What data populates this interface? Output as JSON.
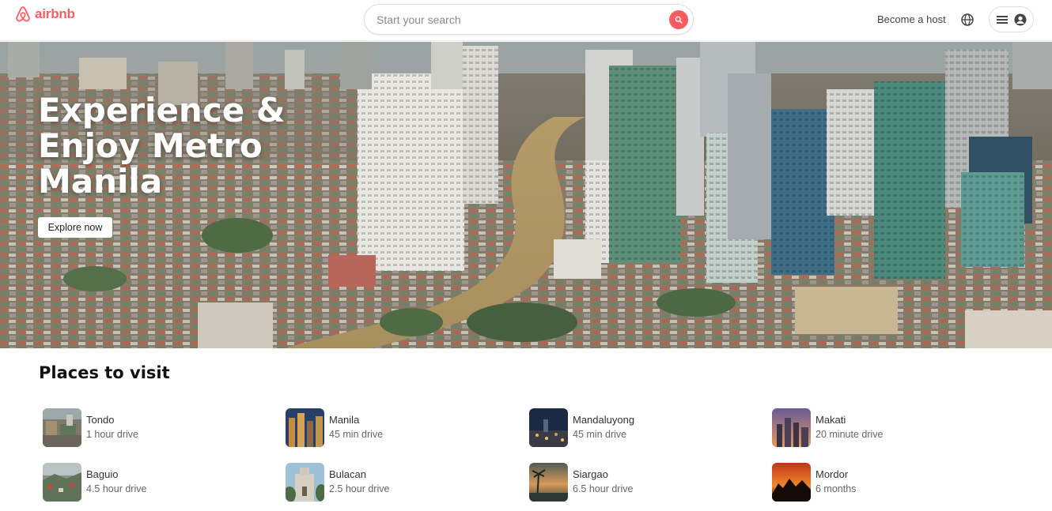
{
  "header": {
    "logo_text": "airbnb",
    "search_placeholder": "Start your search",
    "become_host": "Become a host"
  },
  "hero": {
    "title": "Experience & Enjoy Metro Manila",
    "button": "Explore now"
  },
  "places": {
    "title": "Places to visit",
    "items": [
      {
        "name": "Tondo",
        "distance": "1 hour drive"
      },
      {
        "name": "Manila",
        "distance": "45 min drive"
      },
      {
        "name": "Mandaluyong",
        "distance": "45 min drive"
      },
      {
        "name": "Makati",
        "distance": "20 minute drive"
      },
      {
        "name": "Baguio",
        "distance": "4.5 hour drive"
      },
      {
        "name": "Bulacan",
        "distance": "2.5 hour drive"
      },
      {
        "name": "Siargao",
        "distance": "6.5 hour drive"
      },
      {
        "name": "Mordor",
        "distance": "6 months"
      }
    ]
  },
  "colors": {
    "brand": "#ff5a5f",
    "text": "#222222",
    "muted": "#666666"
  },
  "icons": [
    "airbnb-logo-icon",
    "search-icon",
    "globe-icon",
    "menu-icon",
    "user-icon"
  ]
}
